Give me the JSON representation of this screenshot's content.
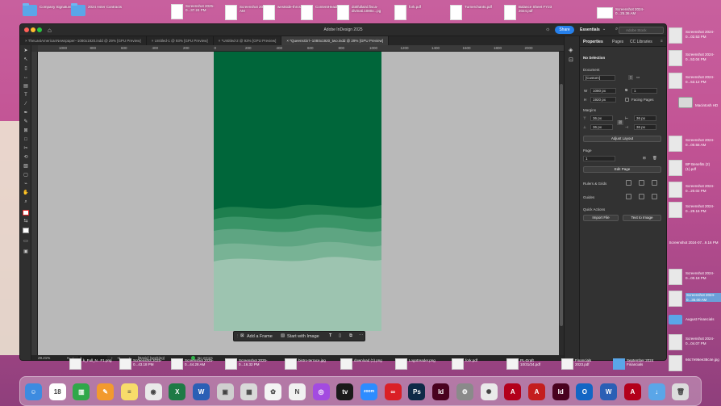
{
  "desktop_top": [
    {
      "label": "Company Signatures",
      "kind": "folder"
    },
    {
      "label": "2024 Aster Contracts",
      "kind": "folder"
    },
    {
      "label": "Screenshot 2025-0...37.24 PM",
      "kind": "thumb"
    },
    {
      "label": "Screenshot 2025...46 AM",
      "kind": "thumb"
    },
    {
      "label": "westside-thrcs.jpg",
      "kind": "thumb"
    },
    {
      "label": "ContentHeadery.jpg",
      "kind": "thumb"
    },
    {
      "label": "dokfullaird.fisca-divinati.1080x...pg",
      "kind": "thumb"
    },
    {
      "label": "fork.pdf",
      "kind": "thumb"
    },
    {
      "label": "Turnerchants.pdf",
      "kind": "thumb"
    },
    {
      "label": "Balance Sheet FY23 2024.pdf",
      "kind": "thumb"
    },
    {
      "label": "Screenshot 2024-0...25.36 AM",
      "kind": "thumb"
    }
  ],
  "window": {
    "title": "Adobe InDesign 2025",
    "share": "Share",
    "workspace": "Essentials",
    "search_placeholder": "Adobe Stock",
    "tabs": [
      "TheLastAmericanNewspaper--1080x1920.indd @ 29% [GPU Preview]",
      "Untitled-1 @ 93% [GPU Preview]",
      "*Untitled-2 @ 93% [GPU Preview]",
      "*QueensGirl--1080x1920_two.indd @ 29% [GPU Preview]"
    ],
    "ruler_ticks": [
      "1000",
      "800",
      "600",
      "400",
      "200",
      "0",
      "200",
      "400",
      "600",
      "800",
      "1000",
      "1200",
      "1400",
      "1600",
      "1800",
      "2000"
    ]
  },
  "panel": {
    "tabs": [
      "Properties",
      "Pages",
      "CC Libraries"
    ],
    "selection": "No Selection",
    "document_label": "Document",
    "preset": "[Custom]",
    "w_label": "W",
    "w_value": "1080 px",
    "h_label": "H",
    "h_value": "1920 px",
    "pages_count": "1",
    "facing_pages": "Facing Pages",
    "margins_label": "Margins",
    "m_top": "36 px",
    "m_bottom": "36 px",
    "m_left": "36 px",
    "m_right": "36 px",
    "adjust_layout": "Adjust Layout",
    "page_label": "Page",
    "page_value": "1",
    "edit_page": "Edit Page",
    "rulers_grids": "Rulers & Grids",
    "guides": "Guides",
    "quick_actions": "Quick Actions",
    "import_file": "Import File",
    "text_to_image": "Text to Image"
  },
  "context_bar": {
    "add_frame": "Add a Frame",
    "start_with_image": "Start with Image"
  },
  "status": {
    "zoom": "29.21%",
    "page": "1",
    "style": "[Basic] (working)",
    "errors": "No errors"
  },
  "desktop_right": [
    "Screenshot 2024-0...02.53 PM",
    "Screenshot 2024-0...53.04 PM",
    "Screenshot 2024-0...53.12 PM",
    "Macintosh HD",
    "Screenshot 2024-0...00.55 AM",
    "BP Benefits (2) (1).pdf",
    "Screenshot 2024-0...20.02 PM",
    "Screenshot 2024-0...29.16 PM",
    "Screenshot 2024-07...9.16 PM",
    "Screenshot 2024-0...00.18 PM",
    "Screenshot 2024-0...35.00 AM",
    "August Financials",
    "Screenshot 2024-0...04.07 PM",
    "66c7e96ee38c4e.jpg"
  ],
  "dock_thumbs": [
    "k_Full_N...F1.png",
    "Screenshot 2025-0...43.18 PM",
    "Screenshot 2025-0...44.28 AM",
    "Screenshot 2025-0...16.32 PM",
    "bistro-terrace.jpg",
    "download (1).png",
    "Logotreader.png",
    "fork.pdf",
    "PL-Draft 10/31/24.pdf",
    "Financials 2023.pdf",
    "September 2024 Financials"
  ],
  "dock_apps": [
    {
      "name": "Finder",
      "color": "#3d8be0",
      "glyph": "☺"
    },
    {
      "name": "Calendar",
      "color": "#ffffff",
      "glyph": "18"
    },
    {
      "name": "Numbers",
      "color": "#2fa84a",
      "glyph": "▥"
    },
    {
      "name": "Pages",
      "color": "#f29a2e",
      "glyph": "✎"
    },
    {
      "name": "Notes",
      "color": "#f7dc6a",
      "glyph": "≡"
    },
    {
      "name": "Chrome",
      "color": "#e9e9e9",
      "glyph": "◉"
    },
    {
      "name": "Excel",
      "color": "#1d7a45",
      "glyph": "X"
    },
    {
      "name": "Word",
      "color": "#2b5fb5",
      "glyph": "W"
    },
    {
      "name": "Preview",
      "color": "#cfcfcf",
      "glyph": "▣"
    },
    {
      "name": "Launchpad",
      "color": "#d9d9d9",
      "glyph": "▦"
    },
    {
      "name": "Photos",
      "color": "#f4f4f4",
      "glyph": "✿"
    },
    {
      "name": "News",
      "color": "#f1f1f1",
      "glyph": "N"
    },
    {
      "name": "Podcasts",
      "color": "#a34be0",
      "glyph": "◎"
    },
    {
      "name": "Apple TV",
      "color": "#1a1a1a",
      "glyph": "tv"
    },
    {
      "name": "Zoom",
      "color": "#2d8cff",
      "glyph": "zoom"
    },
    {
      "name": "Creative Cloud",
      "color": "#da1f26",
      "glyph": "∞"
    },
    {
      "name": "Photoshop",
      "color": "#0e2a47",
      "glyph": "Ps"
    },
    {
      "name": "InDesign",
      "color": "#49021f",
      "glyph": "Id"
    },
    {
      "name": "Settings",
      "color": "#8a8a8a",
      "glyph": "⚙"
    },
    {
      "name": "ChatGPT",
      "color": "#eaeaea",
      "glyph": "✺"
    },
    {
      "name": "Acrobat",
      "color": "#b3001b",
      "glyph": "A"
    },
    {
      "name": "Acrobat Pro",
      "color": "#c41e1e",
      "glyph": "A"
    },
    {
      "name": "InDesign 2",
      "color": "#49021f",
      "glyph": "Id"
    },
    {
      "name": "Outlook",
      "color": "#1366c4",
      "glyph": "O"
    },
    {
      "name": "Word doc",
      "color": "#2b5fb5",
      "glyph": "W"
    },
    {
      "name": "PDF",
      "color": "#b3001b",
      "glyph": "A"
    },
    {
      "name": "Downloads",
      "color": "#5aa6e8",
      "glyph": "↓"
    },
    {
      "name": "Trash",
      "color": "#dcdcdc",
      "glyph": "🗑"
    }
  ],
  "colors": {
    "dark_green": "#00663a",
    "mid_green": "#3f8f66",
    "pale_green": "#9dc4b0",
    "accent_blue": "#2680eb"
  }
}
